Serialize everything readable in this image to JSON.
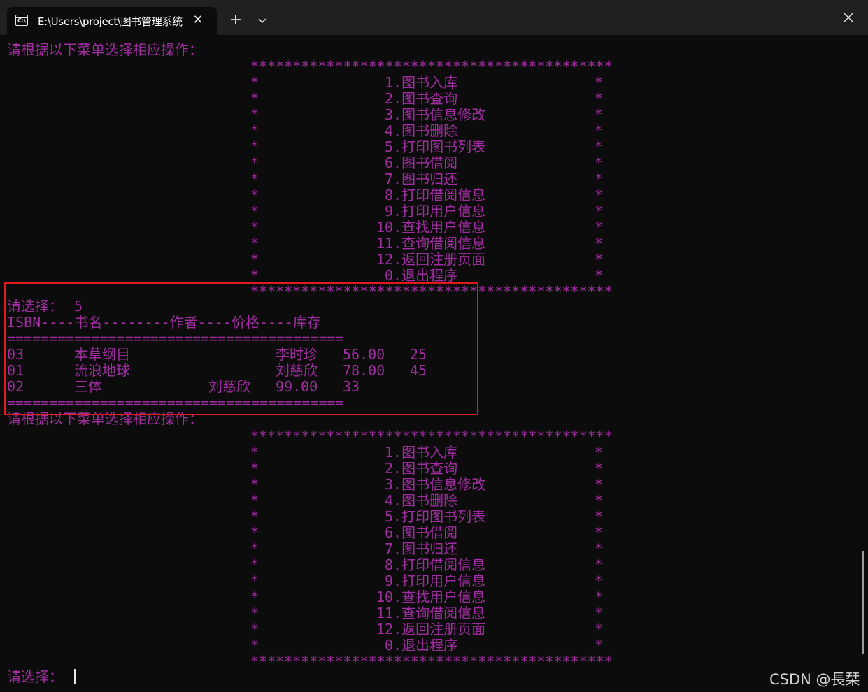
{
  "window": {
    "tab_title": "E:\\Users\\project\\图书管理系统",
    "tab_icon": "console-icon",
    "close_tab": "✕",
    "new_tab": "+",
    "dropdown_icon": "chevron-down-icon",
    "controls": [
      "minimize-icon",
      "maximize-icon",
      "close-icon"
    ]
  },
  "colors": {
    "console_text": "#a12ea1",
    "background": "#0c0c0c",
    "highlight_box": "#e01b1b"
  },
  "console": {
    "prompt_menu": "请根据以下菜单选择相应操作：",
    "menu_border": "*******************************************",
    "menu_items": [
      "1.图书入库",
      "2.图书查询",
      "3.图书信息修改",
      "4.图书删除",
      "5.打印图书列表",
      "6.图书借阅",
      "7.图书归还",
      "8.打印借阅信息",
      "9.打印用户信息",
      "10.查找用户信息",
      "11.查询借阅信息",
      "12.返回注册页面",
      "0.退出程序"
    ],
    "select_prompt": "请选择：",
    "selection_value": "5",
    "table_header": "ISBN----书名--------作者----价格----库存",
    "table_separator": "========================================",
    "table_rows": [
      {
        "isbn": "03",
        "title": "本草纲目",
        "author": "李时珍",
        "price": "56.00",
        "stock": "25"
      },
      {
        "isbn": "01",
        "title": "流浪地球",
        "author": "刘慈欣",
        "price": "78.00",
        "stock": "45"
      },
      {
        "isbn": "02",
        "title": "三体",
        "author": "刘慈欣",
        "price": "99.00",
        "stock": "33"
      }
    ]
  },
  "watermark": "CSDN @長栞"
}
